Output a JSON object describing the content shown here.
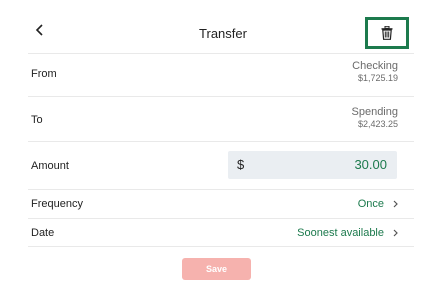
{
  "header": {
    "title": "Transfer",
    "back_icon": "chevron-left-icon",
    "delete_icon": "trash-icon",
    "delete_highlight_color": "#1c7a4d"
  },
  "rows": {
    "from": {
      "label": "From",
      "account": "Checking",
      "balance": "$1,725.19"
    },
    "to": {
      "label": "To",
      "account": "Spending",
      "balance": "$2,423.25"
    },
    "amount": {
      "label": "Amount",
      "currency": "$",
      "value": "30.00"
    },
    "frequency": {
      "label": "Frequency",
      "value": "Once"
    },
    "date": {
      "label": "Date",
      "value": "Soonest available"
    }
  },
  "actions": {
    "save_label": "Save",
    "save_color": "#f6b2ae"
  },
  "colors": {
    "accent": "#1c7a4d",
    "input_bg": "#eaeef2"
  }
}
